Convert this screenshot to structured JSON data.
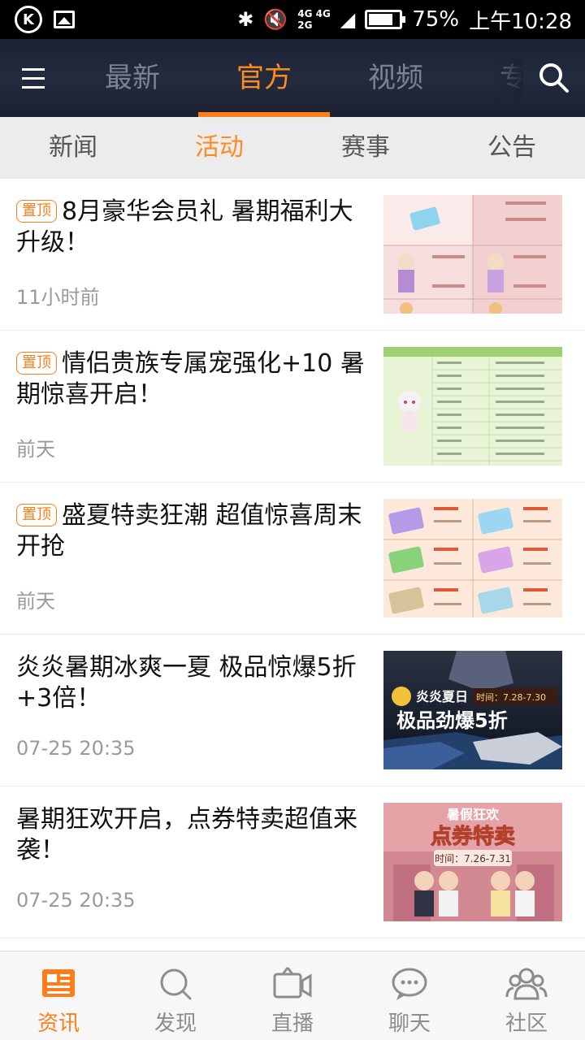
{
  "status": {
    "net_top": "4G 4G",
    "net_bottom": "2G",
    "battery": "75%",
    "time": "上午10:28"
  },
  "nav": {
    "tabs": [
      "最新",
      "官方",
      "视频",
      "专栏"
    ],
    "active_tab": "官方"
  },
  "subtabs": {
    "items": [
      "新闻",
      "活动",
      "赛事",
      "公告"
    ],
    "active": "活动"
  },
  "items": [
    {
      "pinned": true,
      "badge": "置顶",
      "title": "8月豪华会员礼 暑期福利大升级！",
      "time": "11小时前",
      "thumb": "vip-gift"
    },
    {
      "pinned": true,
      "badge": "置顶",
      "title": "情侣贵族专属宠强化+10 暑期惊喜开启！",
      "time": "前天",
      "thumb": "pet-table"
    },
    {
      "pinned": true,
      "badge": "置顶",
      "title": "盛夏特卖狂潮 超值惊喜周末开抢",
      "time": "前天",
      "thumb": "ticket-grid"
    },
    {
      "pinned": false,
      "badge": "",
      "title": "炎炎暑期冰爽一夏 极品惊爆5折+3倍！",
      "time": "07-25 20:35",
      "thumb": "racing-banner",
      "banner_line1": "炎炎夏日",
      "banner_date": "时间：7.28-7.30",
      "banner_line2": "极品劲爆5折"
    },
    {
      "pinned": false,
      "badge": "",
      "title": "暑期狂欢开启，点券特卖超值来袭！",
      "time": "07-25 20:35",
      "thumb": "voucher-banner",
      "banner_line1": "暑假狂欢",
      "banner_line2": "点券特卖",
      "banner_date": "时间：7.26-7.31"
    }
  ],
  "bottom_nav": [
    {
      "label": "资讯",
      "icon": "news-icon",
      "active": true
    },
    {
      "label": "发现",
      "icon": "discover-icon",
      "active": false
    },
    {
      "label": "直播",
      "icon": "live-icon",
      "active": false
    },
    {
      "label": "聊天",
      "icon": "chat-icon",
      "active": false
    },
    {
      "label": "社区",
      "icon": "community-icon",
      "active": false
    }
  ],
  "colors": {
    "accent": "#ff7d1a",
    "nav_bg": "#1f2637",
    "subtab_bg": "#ececec"
  }
}
